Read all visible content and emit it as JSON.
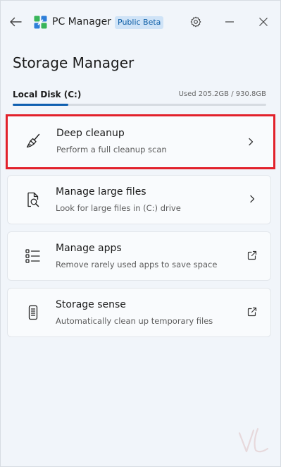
{
  "app": {
    "title": "PC Manager",
    "badge": "Public Beta",
    "icons": {
      "back": "back-arrow-icon",
      "logo": "pc-manager-logo-icon",
      "settings": "gear-icon",
      "minimize": "minimize-icon",
      "close": "close-icon"
    }
  },
  "page": {
    "title": "Storage Manager"
  },
  "disk": {
    "tab_label": "Local Disk (C:)",
    "usage_text": "Used 205.2GB / 930.8GB",
    "used_fraction": 0.22
  },
  "cards": [
    {
      "title": "Deep cleanup",
      "subtitle": "Perform a full cleanup scan",
      "icon": "broom-icon",
      "action_icon": "chevron-right-icon"
    },
    {
      "title": "Manage large files",
      "subtitle": "Look for large files in (C:) drive",
      "icon": "file-search-icon",
      "action_icon": "chevron-right-icon"
    },
    {
      "title": "Manage apps",
      "subtitle": "Remove rarely used apps to save space",
      "icon": "app-list-icon",
      "action_icon": "open-external-icon"
    },
    {
      "title": "Storage sense",
      "subtitle": "Automatically clean up temporary files",
      "icon": "phone-storage-icon",
      "action_icon": "open-external-icon"
    }
  ],
  "colors": {
    "accent": "#0f5fb0",
    "highlight_border": "#e2212b",
    "badge_bg": "#cfe3f7",
    "badge_text": "#0d5ea6",
    "background": "#f1f5fa"
  }
}
